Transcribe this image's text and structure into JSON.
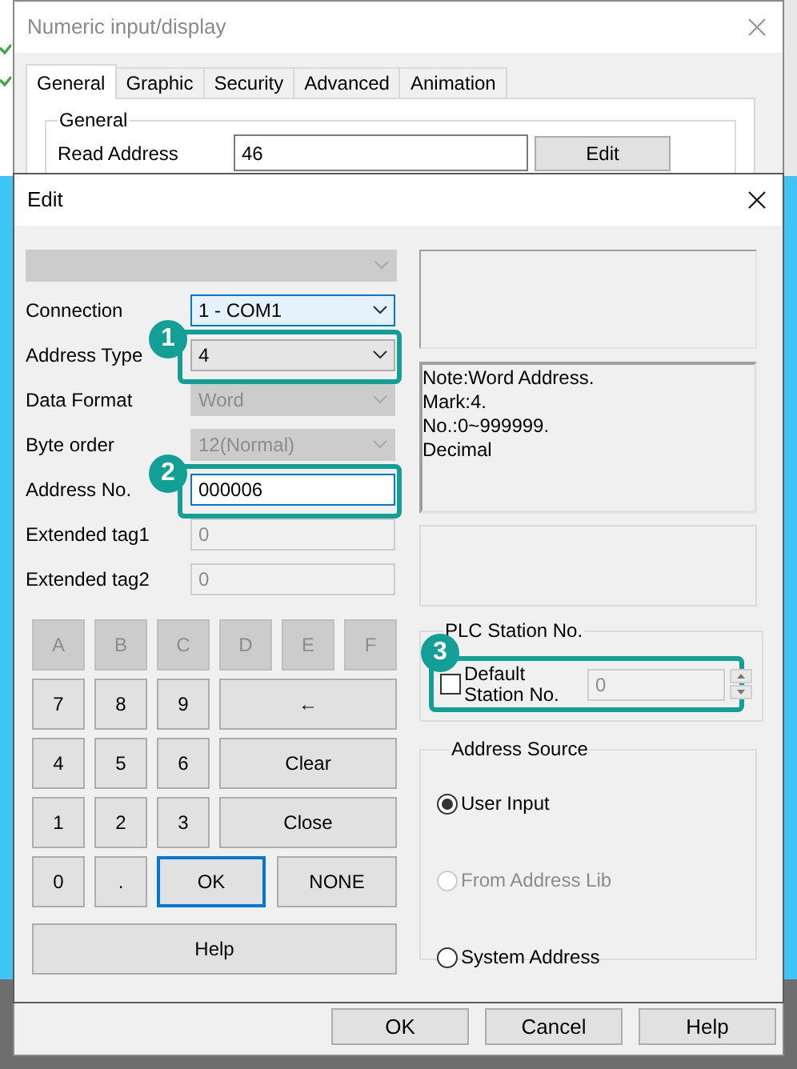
{
  "main_window": {
    "title": "Numeric input/display",
    "tabs": [
      {
        "label": "General",
        "selected": true
      },
      {
        "label": "Graphic",
        "selected": false
      },
      {
        "label": "Security",
        "selected": false
      },
      {
        "label": "Advanced",
        "selected": false
      },
      {
        "label": "Animation",
        "selected": false
      }
    ],
    "group_title": "General",
    "read_address": {
      "label": "Read Address",
      "value": "46"
    },
    "edit_button": "Edit",
    "buttons": [
      "OK",
      "Cancel",
      "Help"
    ]
  },
  "dialog": {
    "title": "Edit",
    "fields": [
      {
        "kind": "dropdown",
        "disabled": true,
        "focused": false
      },
      {
        "kind": "dropdown",
        "label": "Connection",
        "value": "1 - COM1",
        "disabled": false,
        "focused": true
      },
      {
        "kind": "dropdown",
        "label": "Address Type",
        "value": "4",
        "disabled": false,
        "focused": false,
        "callout": "1"
      },
      {
        "kind": "dropdown",
        "label": "Data Format",
        "value": "Word",
        "disabled": true,
        "focused": false
      },
      {
        "kind": "dropdown",
        "label": "Byte order",
        "value": "12(Normal)",
        "disabled": true,
        "focused": false
      },
      {
        "kind": "input",
        "label": "Address No.",
        "value": "000006",
        "disabled": false,
        "focused": true,
        "callout": "2"
      },
      {
        "kind": "input",
        "label": "Extended tag1",
        "value": "0",
        "disabled": true,
        "focused": false
      },
      {
        "kind": "input",
        "label": "Extended tag2",
        "value": "0",
        "disabled": true,
        "focused": false
      }
    ],
    "keypad": [
      [
        {
          "label": "A",
          "kind": "small",
          "disabled": true,
          "focused": false
        },
        {
          "label": "B",
          "kind": "small",
          "disabled": true,
          "focused": false
        },
        {
          "label": "C",
          "kind": "small",
          "disabled": true,
          "focused": false
        },
        {
          "label": "D",
          "kind": "small",
          "disabled": true,
          "focused": false
        },
        {
          "label": "E",
          "kind": "small",
          "disabled": true,
          "focused": false
        },
        {
          "label": "F",
          "kind": "small",
          "disabled": true,
          "focused": false
        }
      ],
      [
        {
          "label": "7",
          "kind": "small",
          "disabled": false,
          "focused": false
        },
        {
          "label": "8",
          "kind": "small",
          "disabled": false,
          "focused": false
        },
        {
          "label": "9",
          "kind": "small",
          "disabled": false,
          "focused": false
        },
        {
          "label": "←",
          "kind": "wide",
          "disabled": false,
          "focused": false
        }
      ],
      [
        {
          "label": "4",
          "kind": "small",
          "disabled": false,
          "focused": false
        },
        {
          "label": "5",
          "kind": "small",
          "disabled": false,
          "focused": false
        },
        {
          "label": "6",
          "kind": "small",
          "disabled": false,
          "focused": false
        },
        {
          "label": "Clear",
          "kind": "wide",
          "disabled": false,
          "focused": false
        }
      ],
      [
        {
          "label": "1",
          "kind": "small",
          "disabled": false,
          "focused": false
        },
        {
          "label": "2",
          "kind": "small",
          "disabled": false,
          "focused": false
        },
        {
          "label": "3",
          "kind": "small",
          "disabled": false,
          "focused": false
        },
        {
          "label": "Close",
          "kind": "wide",
          "disabled": false,
          "focused": false
        }
      ],
      [
        {
          "label": "0",
          "kind": "small",
          "disabled": false,
          "focused": false
        },
        {
          "label": ".",
          "kind": "small",
          "disabled": false,
          "focused": false
        },
        {
          "label": "OK",
          "kind": "medium",
          "disabled": false,
          "focused": true
        },
        {
          "label": "NONE",
          "kind": "large",
          "disabled": false,
          "focused": false
        }
      ]
    ],
    "help_button": "Help",
    "note_lines": [
      "Note:Word Address.",
      "Mark:4.",
      "No.:0~999999.",
      "Decimal"
    ],
    "plc_station": {
      "title": "PLC Station No.",
      "checkbox": {
        "label": "Default Station No.",
        "checked": false
      },
      "value": "0",
      "disabled": true,
      "callout": "3"
    },
    "address_source": {
      "title": "Address Source",
      "options": [
        {
          "label": "User Input",
          "selected": true,
          "disabled": false
        },
        {
          "label": "From Address Lib",
          "selected": false,
          "disabled": true
        },
        {
          "label": "System Address",
          "selected": false,
          "disabled": false
        }
      ]
    }
  }
}
